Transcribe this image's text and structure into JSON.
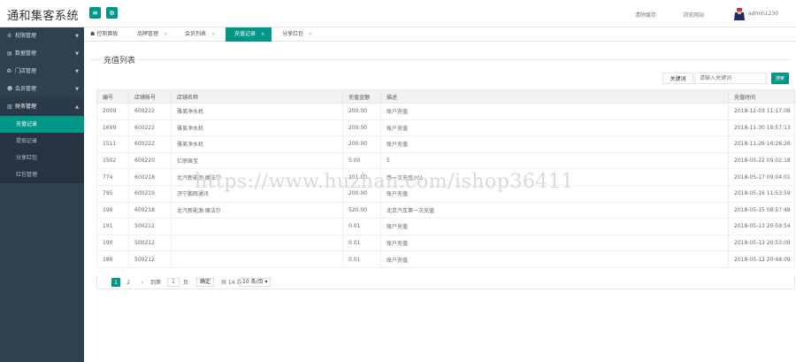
{
  "header": {
    "app_title": "通和集客系统",
    "menu_toggle_icon": "≡",
    "refresh_icon": "⊕",
    "clear_cache": "清除缓存",
    "browse_site": "浏览网站",
    "username": "admin1230"
  },
  "sidebar": {
    "items": [
      {
        "label": "权限管理",
        "icon": "⚙"
      },
      {
        "label": "数据管理",
        "icon": "▤"
      },
      {
        "label": "门店管理",
        "icon": "❂"
      },
      {
        "label": "会员管理",
        "icon": "☻"
      },
      {
        "label": "财务管理",
        "icon": "▥"
      }
    ],
    "sub_items": [
      {
        "label": "充值记录"
      },
      {
        "label": "提现记录"
      },
      {
        "label": "分享红包"
      },
      {
        "label": "红包管理"
      }
    ]
  },
  "tabs": [
    {
      "label": "控制面板"
    },
    {
      "label": "品牌管理"
    },
    {
      "label": "会员列表"
    },
    {
      "label": "充值记录"
    },
    {
      "label": "分享红包"
    }
  ],
  "panel": {
    "title": "充值列表",
    "keyword_button": "关键词",
    "search_placeholder": "请输入关键词",
    "search_button": "搜索"
  },
  "table": {
    "headers": [
      "编号",
      "店铺帐号",
      "店铺名称",
      "充值金额",
      "描述",
      "充值时间"
    ],
    "rows": [
      [
        "2009",
        "600222",
        "雅美净水机",
        "200.00",
        "账户充值",
        "2018-12-03 11:17:08"
      ],
      [
        "1699",
        "600222",
        "雅美净水机",
        "200.00",
        "账户充值",
        "2018-11-30 19:57:13"
      ],
      [
        "1511",
        "600222",
        "雅美净水机",
        "200.00",
        "账户充值",
        "2018-11-26 16:26:26"
      ],
      [
        "1502",
        "600220",
        "亿丽珠宝",
        "5.00",
        "5",
        "2018-05-22 09:02:18"
      ],
      [
        "774",
        "600218",
        "北汽新能源·魔法尔",
        "201.00",
        "第一次充值201",
        "2018-05-17 09:04:01"
      ],
      [
        "795",
        "600219",
        "济宁鹏晖通讯",
        "200.00",
        "账户充值",
        "2018-05-16 11:53:59"
      ],
      [
        "199",
        "600218",
        "北汽新能源·魔法尔",
        "520.00",
        "北京汽车第一次充值",
        "2018-05-15 08:57:48"
      ],
      [
        "191",
        "500212",
        "",
        "0.01",
        "账户充值",
        "2018-05-13 20:59:54"
      ],
      [
        "190",
        "500212",
        "",
        "0.01",
        "账户充值",
        "2018-05-13 20:53:09"
      ],
      [
        "189",
        "500212",
        "",
        "0.01",
        "账户充值",
        "2018-05-13 20:48:09"
      ]
    ]
  },
  "pager": {
    "prev": "‹",
    "pages": [
      "1",
      "2"
    ],
    "next": "›",
    "goto_label": "到第",
    "goto_value": "1",
    "page_unit": "页",
    "confirm": "确定",
    "total": "共 14 条",
    "per_page": "10 条/页 ▾"
  },
  "watermark": "https://www.huzhan.com/ishop36411",
  "colors": {
    "accent": "#009688",
    "sidebar": "#2f4050"
  }
}
